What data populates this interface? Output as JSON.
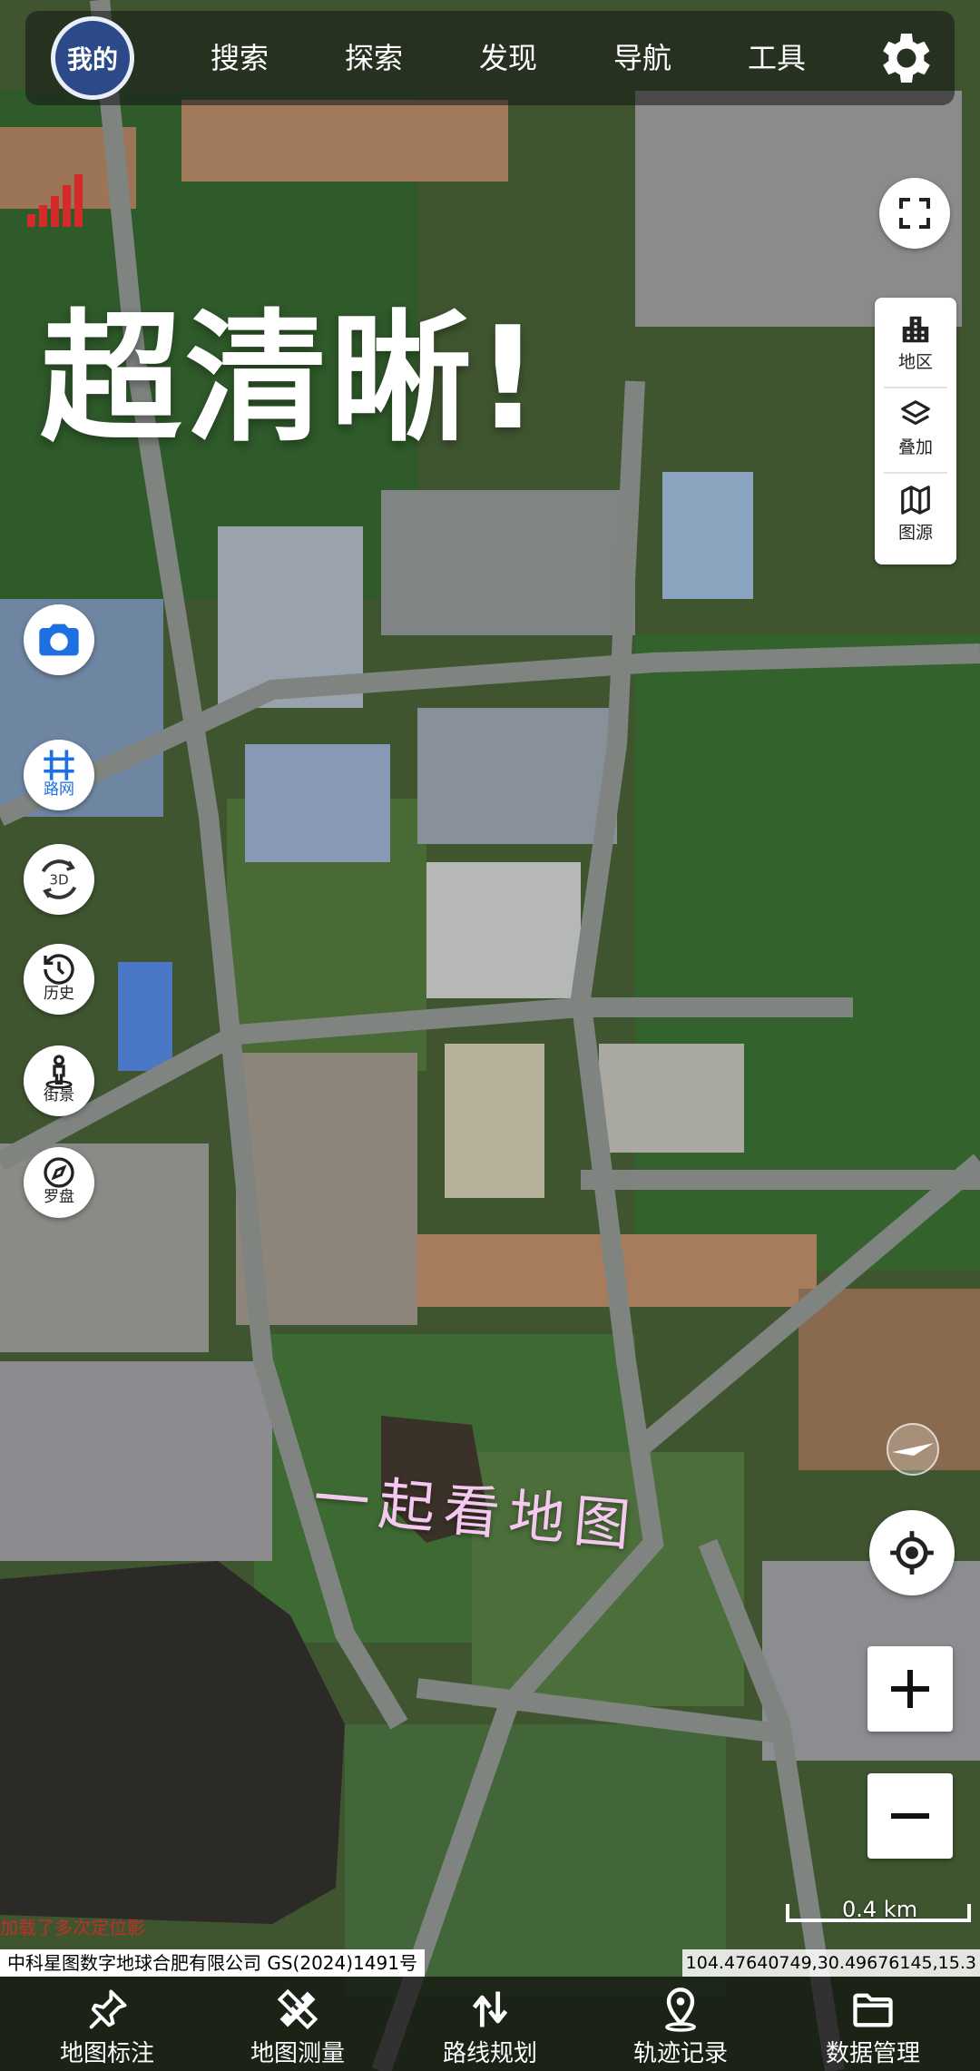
{
  "topnav": {
    "avatar_label": "我的",
    "items": [
      "搜索",
      "探索",
      "发现",
      "导航",
      "工具"
    ]
  },
  "overlay": {
    "headline": "超清晰!",
    "handwritten": "一起看地图"
  },
  "layers": {
    "items": [
      {
        "label": "地区",
        "icon": "building-icon"
      },
      {
        "label": "叠加",
        "icon": "layers-icon"
      },
      {
        "label": "图源",
        "icon": "map-icon"
      }
    ]
  },
  "tools": [
    {
      "label": "",
      "icon": "camera-icon"
    },
    {
      "label": "路网",
      "icon": "road-network-icon"
    },
    {
      "label": "",
      "icon": "3d-icon"
    },
    {
      "label": "历史",
      "icon": "history-icon"
    },
    {
      "label": "街景",
      "icon": "street-view-icon"
    },
    {
      "label": "罗盘",
      "icon": "compass-icon"
    }
  ],
  "scale": {
    "label": "0.4 km"
  },
  "footer": {
    "copyright": "中科星图数字地球合肥有限公司 GS(2024)1491号",
    "coordinates": "104.47640749,30.49676145,15.3",
    "watermark": "加载了多次定位影"
  },
  "bottom_tabs": [
    {
      "label": "地图标注",
      "icon": "pin-icon"
    },
    {
      "label": "地图测量",
      "icon": "ruler-icon"
    },
    {
      "label": "路线规划",
      "icon": "route-icon"
    },
    {
      "label": "轨迹记录",
      "icon": "location-icon"
    },
    {
      "label": "数据管理",
      "icon": "folder-icon"
    }
  ],
  "colors": {
    "topbar_bg": "#141414",
    "handwriting": "#f5c8ef",
    "accent_blue": "#1e6fe0",
    "signal_red": "#d42a2a"
  }
}
